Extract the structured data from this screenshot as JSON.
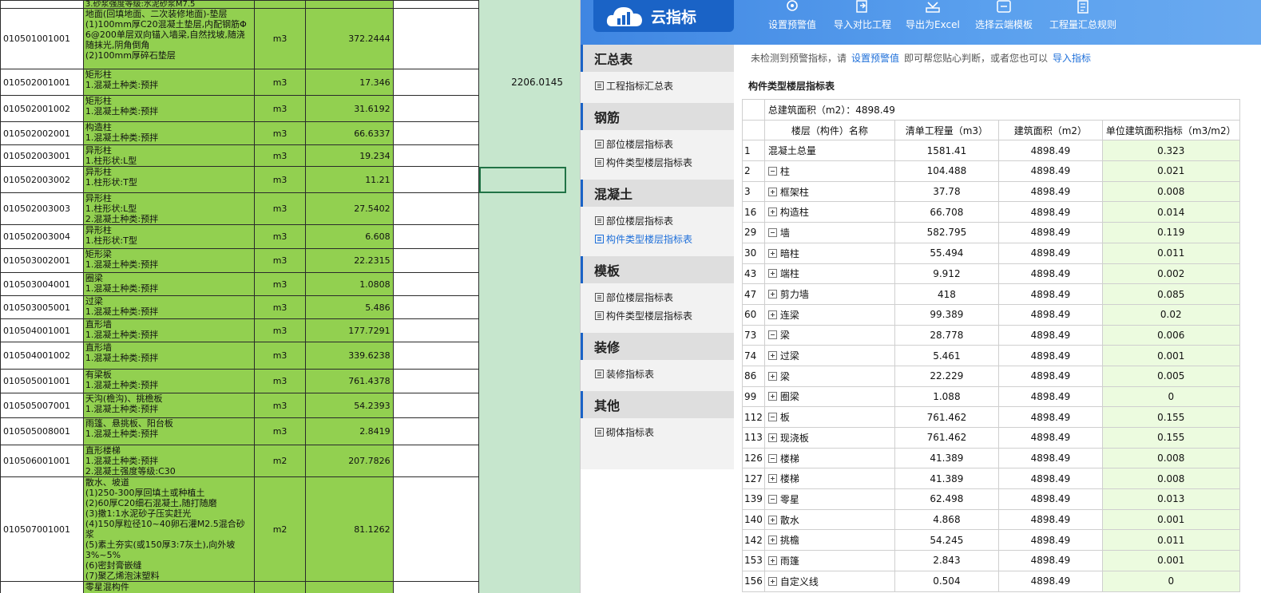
{
  "sheet": {
    "top_partial_text": "3.砂浆强度等级:水泥砂浆M7.5",
    "rows": [
      {
        "code": "010501001001",
        "desc": "地面(回填地面、二次装修地面)-垫层\n(1)100mm厚C20混凝土垫层,内配钢筋Φ\n6@200单层双向锚入墙梁,自然找坡,随浇\n随抹光,阴角倒角\n(2)100mm厚碎石垫层",
        "unit": "m3",
        "qty": "372.2444",
        "extra": ""
      },
      {
        "code": "010502001001",
        "desc": "矩形柱\n1.混凝土种类:预拌",
        "unit": "m3",
        "qty": "17.346",
        "extra": "2206.0145"
      },
      {
        "code": "010502001002",
        "desc": "矩形柱\n1.混凝土种类:预拌",
        "unit": "m3",
        "qty": "31.6192",
        "extra": ""
      },
      {
        "code": "010502002001",
        "desc": "构造柱\n1.混凝土种类:预拌",
        "unit": "m3",
        "qty": "66.6337",
        "extra": ""
      },
      {
        "code": "010502003001",
        "desc": "异形柱\n1.柱形状:L型",
        "unit": "m3",
        "qty": "19.234",
        "extra": ""
      },
      {
        "code": "010502003002",
        "desc": "异形柱\n1.柱形状:T型",
        "unit": "m3",
        "qty": "11.21",
        "extra": ""
      },
      {
        "code": "010502003003",
        "desc": "异形柱\n1.柱形状:L型\n2.混凝土种类:预拌",
        "unit": "m3",
        "qty": "27.5402",
        "extra": ""
      },
      {
        "code": "010502003004",
        "desc": "异形柱\n1.柱形状:T型",
        "unit": "m3",
        "qty": "6.608",
        "extra": ""
      },
      {
        "code": "010503002001",
        "desc": "矩形梁\n1.混凝土种类:预拌",
        "unit": "m3",
        "qty": "22.2315",
        "extra": ""
      },
      {
        "code": "010503004001",
        "desc": "圈梁\n1.混凝土种类:预拌",
        "unit": "m3",
        "qty": "1.0808",
        "extra": ""
      },
      {
        "code": "010503005001",
        "desc": "过梁\n1.混凝土种类:预拌",
        "unit": "m3",
        "qty": "5.486",
        "extra": ""
      },
      {
        "code": "010504001001",
        "desc": "直形墙\n1.混凝土种类:预拌",
        "unit": "m3",
        "qty": "177.7291",
        "extra": ""
      },
      {
        "code": "010504001002",
        "desc": "直形墙\n1.混凝土种类:预拌",
        "unit": "m3",
        "qty": "339.6238",
        "extra": ""
      },
      {
        "code": "010505001001",
        "desc": "有梁板\n1.混凝土种类:预拌",
        "unit": "m3",
        "qty": "761.4378",
        "extra": ""
      },
      {
        "code": "010505007001",
        "desc": "天沟(檐沟)、挑檐板\n1.混凝土种类:预拌",
        "unit": "m3",
        "qty": "54.2393",
        "extra": ""
      },
      {
        "code": "010505008001",
        "desc": "雨篷、悬挑板、阳台板\n1.混凝土种类:预拌",
        "unit": "m3",
        "qty": "2.8419",
        "extra": ""
      },
      {
        "code": "010506001001",
        "desc": "直形楼梯\n1.混凝土种类:预拌\n2.混凝土强度等级:C30",
        "unit": "m2",
        "qty": "207.7826",
        "extra": ""
      },
      {
        "code": "010507001001",
        "desc": "散水、坡道\n(1)250-300厚回填土或种植土\n(2)60厚C20细石混凝土,随打随磨\n(3)撒1:1水泥砂子压实赶光\n(4)150厚粒径10~40卵石灌M2.5混合砂浆\n(5)素土夯实(或150厚3:7灰土),向外坡\n3%~5%\n(6)密封膏嵌缝\n(7)聚乙烯泡沫塑料",
        "unit": "m2",
        "qty": "81.1262",
        "extra": ""
      },
      {
        "code": "",
        "desc": "零星混构件",
        "unit": "",
        "qty": "",
        "extra": ""
      }
    ]
  },
  "app": {
    "logo_title": "云指标",
    "toolbar": [
      {
        "label": "设置预警值",
        "icon": "gear-icon"
      },
      {
        "label": "导入对比工程",
        "icon": "import-icon"
      },
      {
        "label": "导出为Excel",
        "icon": "export-icon"
      },
      {
        "label": "选择云端模板",
        "icon": "template-icon"
      },
      {
        "label": "工程量汇总规则",
        "icon": "rules-icon"
      }
    ],
    "sidebar": [
      {
        "title": "汇总表",
        "items": [
          {
            "label": "工程指标汇总表",
            "active": false
          }
        ]
      },
      {
        "title": "钢筋",
        "items": [
          {
            "label": "部位楼层指标表",
            "active": false
          },
          {
            "label": "构件类型楼层指标表",
            "active": false
          }
        ]
      },
      {
        "title": "混凝土",
        "items": [
          {
            "label": "部位楼层指标表",
            "active": false
          },
          {
            "label": "构件类型楼层指标表",
            "active": true
          }
        ]
      },
      {
        "title": "模板",
        "items": [
          {
            "label": "部位楼层指标表",
            "active": false
          },
          {
            "label": "构件类型楼层指标表",
            "active": false
          }
        ]
      },
      {
        "title": "装修",
        "items": [
          {
            "label": "装修指标表",
            "active": false
          }
        ]
      },
      {
        "title": "其他",
        "items": [
          {
            "label": "砌体指标表",
            "active": false
          }
        ]
      }
    ],
    "notice": {
      "prefix": "未检测到预警指标，请",
      "link1": "设置预警值",
      "middle": "即可帮您贴心判断，或者您也可以",
      "link2": "导入指标"
    },
    "content_title": "构件类型楼层指标表",
    "total_area": "总建筑面积（m2）：4898.49",
    "columns": [
      "楼层（构件）名称",
      "清单工程量（m3）",
      "建筑面积（m2）",
      "单位建筑面积指标（m3/m2）"
    ],
    "rows": [
      {
        "num": "1",
        "name": "混凝土总量",
        "toggle": "",
        "level": 0,
        "qty": "1581.41",
        "area": "4898.49",
        "idx": "0.323"
      },
      {
        "num": "2",
        "name": "柱",
        "toggle": "minus",
        "level": 0,
        "qty": "104.488",
        "area": "4898.49",
        "idx": "0.021"
      },
      {
        "num": "3",
        "name": "框架柱",
        "toggle": "plus",
        "level": 1,
        "qty": "37.78",
        "area": "4898.49",
        "idx": "0.008"
      },
      {
        "num": "16",
        "name": "构造柱",
        "toggle": "plus",
        "level": 1,
        "qty": "66.708",
        "area": "4898.49",
        "idx": "0.014"
      },
      {
        "num": "29",
        "name": "墙",
        "toggle": "minus",
        "level": 0,
        "qty": "582.795",
        "area": "4898.49",
        "idx": "0.119"
      },
      {
        "num": "30",
        "name": "暗柱",
        "toggle": "plus",
        "level": 1,
        "qty": "55.494",
        "area": "4898.49",
        "idx": "0.011"
      },
      {
        "num": "43",
        "name": "端柱",
        "toggle": "plus",
        "level": 1,
        "qty": "9.912",
        "area": "4898.49",
        "idx": "0.002"
      },
      {
        "num": "47",
        "name": "剪力墙",
        "toggle": "plus",
        "level": 1,
        "qty": "418",
        "area": "4898.49",
        "idx": "0.085"
      },
      {
        "num": "60",
        "name": "连梁",
        "toggle": "plus",
        "level": 1,
        "qty": "99.389",
        "area": "4898.49",
        "idx": "0.02"
      },
      {
        "num": "73",
        "name": "梁",
        "toggle": "minus",
        "level": 0,
        "qty": "28.778",
        "area": "4898.49",
        "idx": "0.006"
      },
      {
        "num": "74",
        "name": "过梁",
        "toggle": "plus",
        "level": 1,
        "qty": "5.461",
        "area": "4898.49",
        "idx": "0.001"
      },
      {
        "num": "86",
        "name": "梁",
        "toggle": "plus",
        "level": 1,
        "qty": "22.229",
        "area": "4898.49",
        "idx": "0.005"
      },
      {
        "num": "99",
        "name": "圈梁",
        "toggle": "plus",
        "level": 1,
        "qty": "1.088",
        "area": "4898.49",
        "idx": "0"
      },
      {
        "num": "112",
        "name": "板",
        "toggle": "minus",
        "level": 0,
        "qty": "761.462",
        "area": "4898.49",
        "idx": "0.155"
      },
      {
        "num": "113",
        "name": "现浇板",
        "toggle": "plus",
        "level": 1,
        "qty": "761.462",
        "area": "4898.49",
        "idx": "0.155"
      },
      {
        "num": "126",
        "name": "楼梯",
        "toggle": "minus",
        "level": 0,
        "qty": "41.389",
        "area": "4898.49",
        "idx": "0.008"
      },
      {
        "num": "127",
        "name": "楼梯",
        "toggle": "plus",
        "level": 1,
        "qty": "41.389",
        "area": "4898.49",
        "idx": "0.008"
      },
      {
        "num": "139",
        "name": "零星",
        "toggle": "minus",
        "level": 0,
        "qty": "62.498",
        "area": "4898.49",
        "idx": "0.013"
      },
      {
        "num": "140",
        "name": "散水",
        "toggle": "plus",
        "level": 1,
        "qty": "4.868",
        "area": "4898.49",
        "idx": "0.001"
      },
      {
        "num": "142",
        "name": "挑檐",
        "toggle": "plus",
        "level": 1,
        "qty": "54.245",
        "area": "4898.49",
        "idx": "0.011"
      },
      {
        "num": "153",
        "name": "雨篷",
        "toggle": "plus",
        "level": 1,
        "qty": "2.843",
        "area": "4898.49",
        "idx": "0.001"
      },
      {
        "num": "156",
        "name": "自定义线",
        "toggle": "plus",
        "level": 1,
        "qty": "0.504",
        "area": "4898.49",
        "idx": "0"
      }
    ]
  }
}
